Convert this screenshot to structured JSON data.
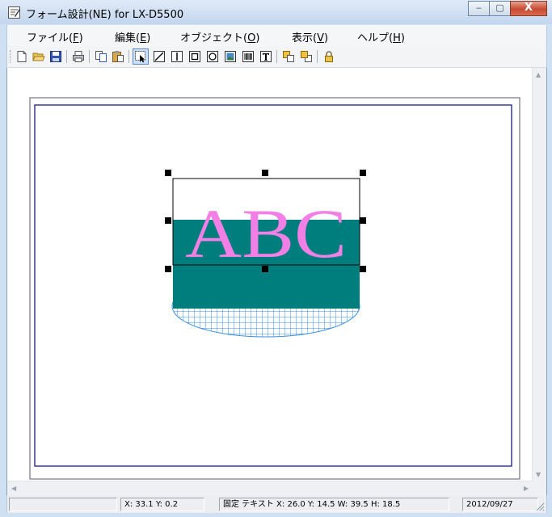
{
  "window": {
    "title": "フォーム設計(NE) for LX-D5500",
    "buttons": {
      "minimize": "‒",
      "maximize": "▢",
      "close": "X"
    }
  },
  "menubar": {
    "items": [
      {
        "label": "ファイル(",
        "key": "F",
        "end": ")"
      },
      {
        "label": "編集(",
        "key": "E",
        "end": ")"
      },
      {
        "label": "オブジェクト(",
        "key": "O",
        "end": ")"
      },
      {
        "label": "表示(",
        "key": "V",
        "end": ")"
      },
      {
        "label": "ヘルプ(",
        "key": "H",
        "end": ")"
      }
    ]
  },
  "toolbar": {
    "buttons": [
      "new-icon",
      "open-icon",
      "save-icon",
      "print-icon",
      "copy-icon",
      "paste-icon",
      "select-tool-icon",
      "line-tool-icon",
      "vertical-line-tool-icon",
      "rectangle-tool-icon",
      "ellipse-tool-icon",
      "image-tool-icon",
      "barcode-tool-icon",
      "text-tool-icon",
      "bring-front-icon",
      "send-back-icon",
      "lock-icon"
    ],
    "active": "select-tool-icon"
  },
  "canvas": {
    "text_object": {
      "text": "ABC",
      "color": "#f27fe6"
    },
    "colors": {
      "teal_fill": "#007e7e",
      "hatch": "#3b8fe0",
      "page_border": "#2a2a8c"
    }
  },
  "statusbar": {
    "coords": "X: 33.1 Y: 0.2",
    "object_info": "固定 テキスト X: 26.0 Y: 14.5 W: 39.5 H: 18.5",
    "date": "2012/09/27"
  }
}
